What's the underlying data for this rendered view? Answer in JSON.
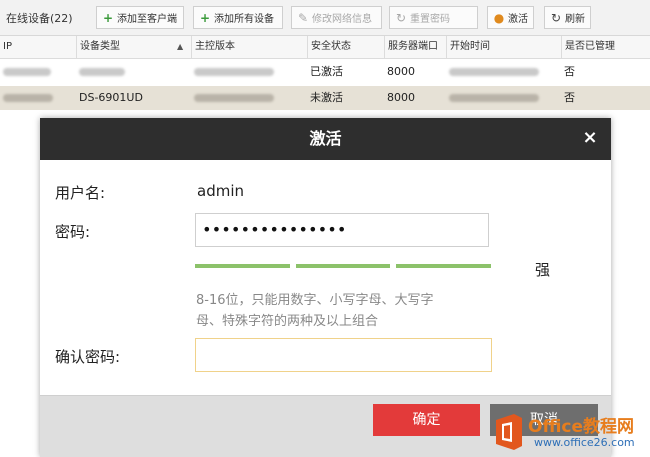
{
  "toolbar": {
    "title": "在线设备(22)",
    "buttons": [
      {
        "label": "添加至客户端",
        "icon": "plus-icon",
        "glyph": "+"
      },
      {
        "label": "添加所有设备",
        "icon": "plus-icon",
        "glyph": "+"
      },
      {
        "label": "修改网络信息",
        "icon": "edit-icon",
        "glyph": "✎"
      },
      {
        "label": "重置密码",
        "icon": "refresh-icon",
        "glyph": "↻"
      },
      {
        "label": "激活",
        "icon": "bulb-icon",
        "glyph": "●"
      },
      {
        "label": "刷新",
        "icon": "refresh-icon",
        "glyph": "↻"
      }
    ]
  },
  "table": {
    "columns": [
      "IP",
      "设备类型",
      "主控版本",
      "安全状态",
      "服务器端口",
      "开始时间",
      "是否已管理"
    ],
    "rows": [
      {
        "ip": "",
        "type": "",
        "version": "",
        "status": "已激活",
        "port": "8000",
        "time": "",
        "managed": "否"
      },
      {
        "ip": "",
        "type": "DS-6901UD",
        "version": "",
        "status": "未激活",
        "port": "8000",
        "time": "",
        "managed": "否"
      }
    ]
  },
  "dialog": {
    "title": "激活",
    "close_glyph": "×",
    "username_label": "用户名:",
    "username_value": "admin",
    "password_label": "密码:",
    "password_value": "•••••••••••••••",
    "strength_label": "强",
    "hint_line1": "8-16位，只能用数字、小写字母、大写字",
    "hint_line2": "母、特殊字符的两种及以上组合",
    "confirm_label": "确认密码:",
    "confirm_value": "",
    "ok_label": "确定",
    "cancel_label": "取消"
  },
  "watermark": {
    "line1": "Office教程网",
    "line2": "www.office26.com"
  },
  "colors": {
    "dialog_header": "#2e2e2e",
    "ok_button": "#e33a3a",
    "cancel_button": "#6e6e6e",
    "strength": "#8cc26a",
    "selected_row": "#e6e1d6"
  }
}
